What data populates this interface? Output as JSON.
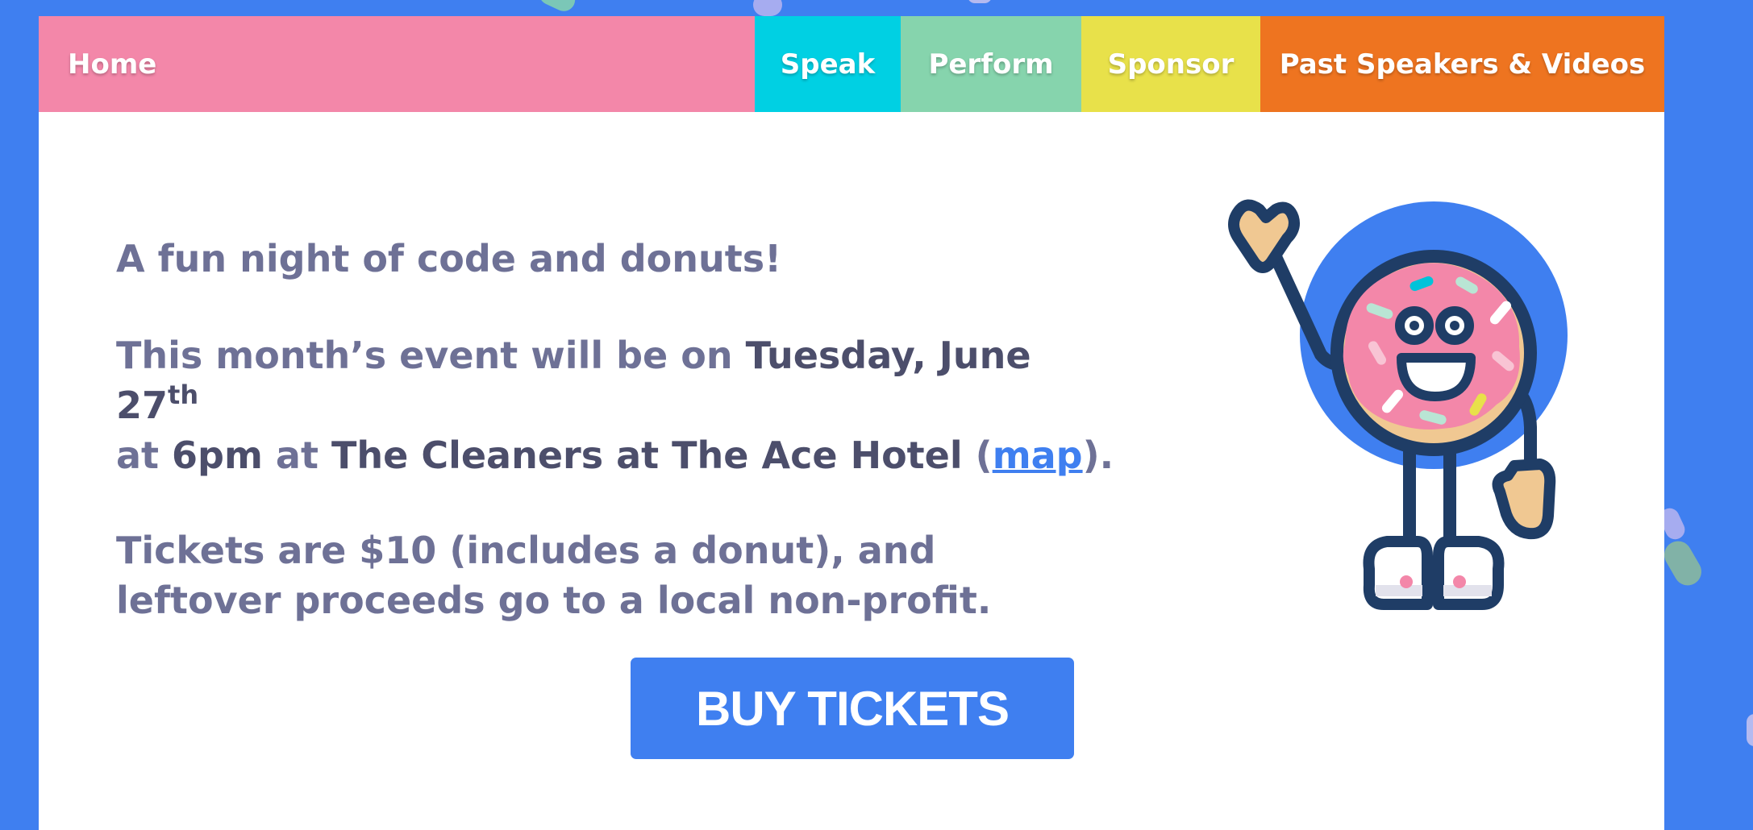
{
  "nav": {
    "home": "Home",
    "speak": "Speak",
    "perform": "Perform",
    "sponsor": "Sponsor",
    "past": "Past Speakers & Videos"
  },
  "content": {
    "tagline": "A fun night of code and donuts!",
    "event_prefix": "This month’s event will be on ",
    "event_date": "Tuesday, June 27",
    "event_date_suffix": "th",
    "event_at1": "at ",
    "event_time": "6pm",
    "event_at2": " at ",
    "event_venue": "The Cleaners at The Ace Hotel",
    "event_paren_open": " (",
    "map_link": "map",
    "event_paren_close": ").",
    "tickets_text": "Tickets are $10 (includes a donut), and leftover proceeds go to a local non-profit."
  },
  "buy_button": "BUY TICKETS",
  "colors": {
    "background": "#3f7ff0",
    "nav_home": "#f387a9",
    "nav_speak": "#00d0e3",
    "nav_perform": "#86d4ad",
    "nav_sponsor": "#e8e14a",
    "nav_past": "#ee7420",
    "text": "#6e7196",
    "text_strong": "#4c4e6b"
  },
  "mascot": {
    "icon": "donut-mascot-icon"
  }
}
